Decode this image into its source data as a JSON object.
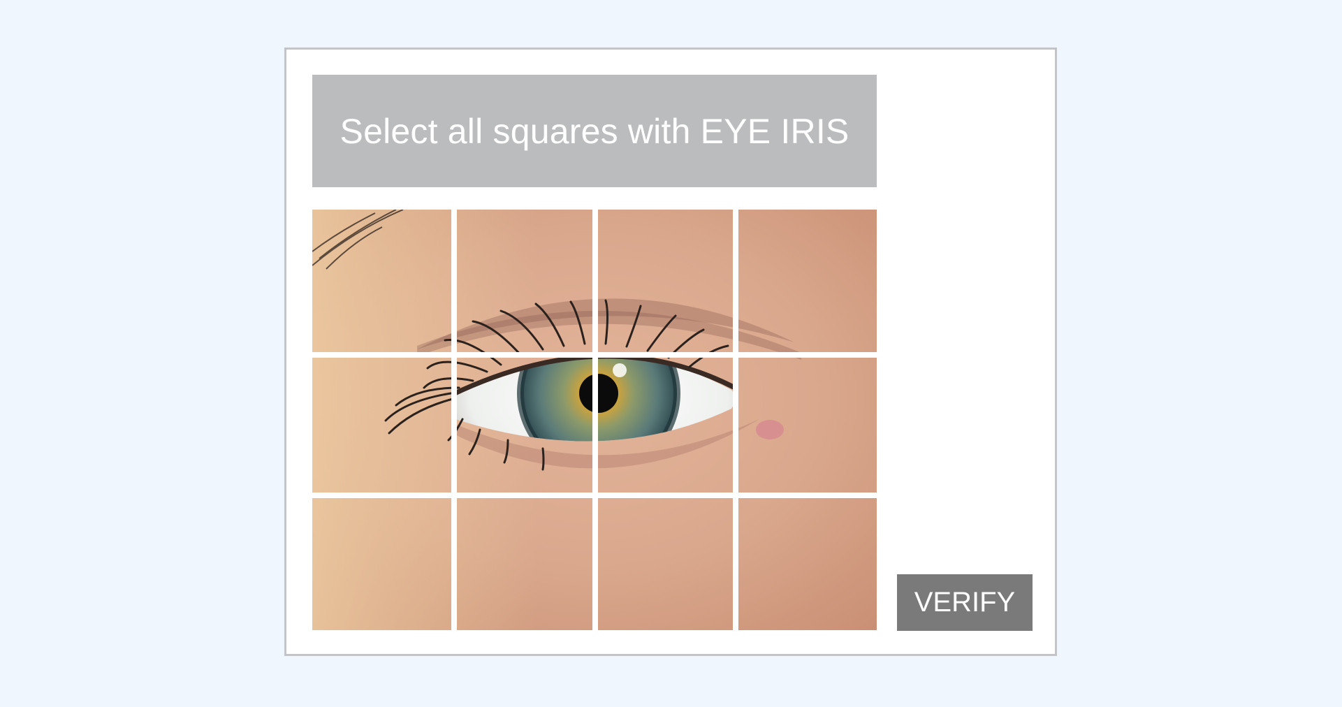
{
  "captcha": {
    "prompt": "Select all squares with EYE IRIS",
    "verify_label": "VERIFY",
    "grid": {
      "rows": 3,
      "columns": 4,
      "tiles": [
        {
          "row": 1,
          "col": 1
        },
        {
          "row": 1,
          "col": 2
        },
        {
          "row": 1,
          "col": 3
        },
        {
          "row": 1,
          "col": 4
        },
        {
          "row": 2,
          "col": 1
        },
        {
          "row": 2,
          "col": 2
        },
        {
          "row": 2,
          "col": 3
        },
        {
          "row": 2,
          "col": 4
        },
        {
          "row": 3,
          "col": 1
        },
        {
          "row": 3,
          "col": 2
        },
        {
          "row": 3,
          "col": 3
        },
        {
          "row": 3,
          "col": 4
        }
      ]
    },
    "image_subject": "close-up-eye-photo"
  },
  "colors": {
    "page_background": "#f0f6fd",
    "card_border": "#c2c4c8",
    "banner_background": "#bbbcbe",
    "button_background": "#7a7a7a",
    "text_on_dark": "#ffffff"
  }
}
